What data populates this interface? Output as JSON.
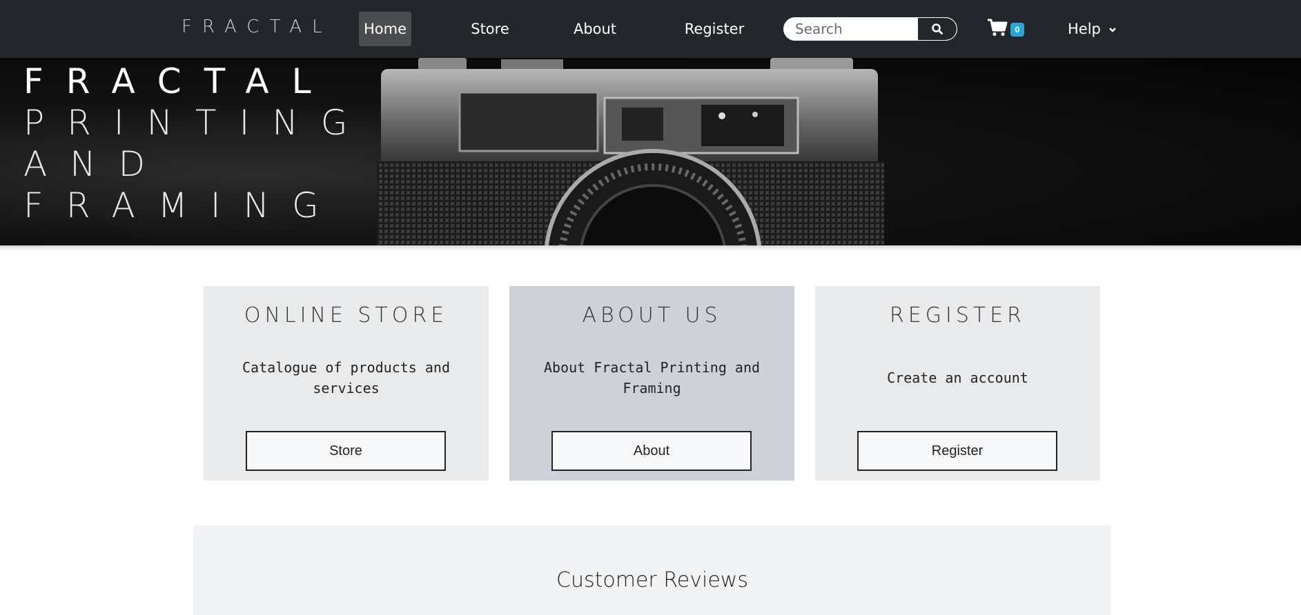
{
  "navbar": {
    "brand": "FRACTAL",
    "items": [
      {
        "label": "Home",
        "active": true
      },
      {
        "label": "Store"
      },
      {
        "label": "About"
      },
      {
        "label": "Register"
      }
    ],
    "search": {
      "placeholder": "Search",
      "value": "",
      "button_icon": "search-icon"
    },
    "cart": {
      "icon": "cart-icon",
      "count": "0"
    },
    "help": {
      "label": "Help",
      "icon": "chevron-down-icon"
    }
  },
  "hero": {
    "lines": [
      "FRACTAL",
      "PRINTING",
      "AND",
      "FRAMING"
    ]
  },
  "cards": [
    {
      "title": "ONLINE STORE",
      "text": "Catalogue of products and services",
      "button": "Store"
    },
    {
      "title": "ABOUT US",
      "text": "About Fractal Printing and Framing",
      "button": "About"
    },
    {
      "title": "REGISTER",
      "text": "Create an account",
      "button": "Register"
    }
  ],
  "reviews": {
    "title": "Customer Reviews"
  },
  "colors": {
    "navbar_bg": "#23272b",
    "active_nav_bg": "#4a4c4e",
    "cart_badge": "#29a8d6",
    "card_bg": "#e8eaec",
    "card_bg_highlight": "#ced2d8"
  }
}
